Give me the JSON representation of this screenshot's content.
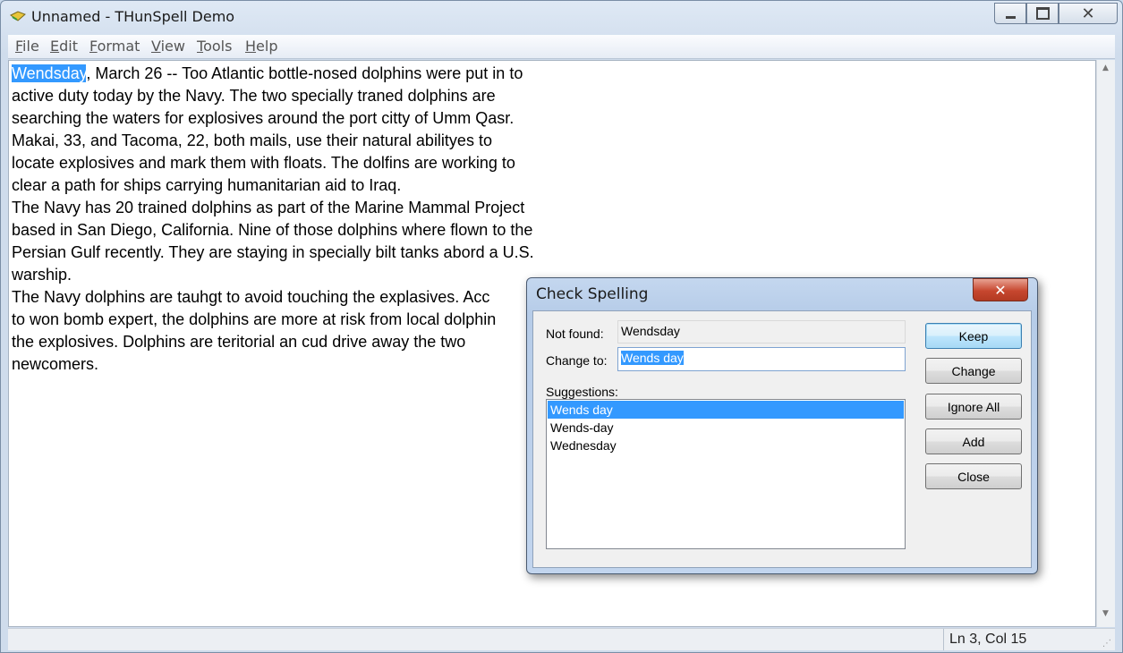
{
  "window": {
    "title": "Unnamed - THunSpell Demo"
  },
  "menu": [
    {
      "label": "File",
      "accel": "F",
      "rest": "ile"
    },
    {
      "label": "Edit",
      "accel": "E",
      "rest": "dit"
    },
    {
      "label": "Format",
      "accel": "F",
      "rest": "ormat"
    },
    {
      "label": "View",
      "accel": "V",
      "rest": "iew"
    },
    {
      "label": "Tools",
      "accel": "T",
      "rest": "ools"
    },
    {
      "label": "Help",
      "accel": "H",
      "rest": "elp"
    }
  ],
  "editor": {
    "selected_word": "Wendsday",
    "text_after_selection": ", March 26 -- Too Atlantic bottle-nosed dolphins were put in to\nactive duty today by the Navy. The two specially traned dolphins are\nsearching the waters for explosives around the port citty of Umm Qasr.\nMakai, 33, and Tacoma, 22, both mails, use their natural abilityes to\nlocate explosives and mark them with floats. The dolfins are working to\nclear a path for ships carrying humanitarian aid to Iraq.\nThe Navy has 20 trained dolphins as part of the Marine Mammal Project\nbased in San Diego, California. Nine of those dolphins where flown to the\nPersian Gulf recently. They are staying in specially bilt tanks abord a U.S.\nwarship.\nThe Navy dolphins are tauhgt to avoid touching the explasives. Acc\nto won bomb expert, the dolphins are more at risk from local dolphin\nthe explosives. Dolphins are teritorial an cud drive away the two\nnewcomers."
  },
  "statusbar": {
    "position": "Ln 3, Col 15"
  },
  "dialog": {
    "title": "Check Spelling",
    "not_found_label": "Not found:",
    "not_found_value": "Wendsday",
    "change_to_label": "Change to:",
    "change_to_value": "Wends day",
    "suggestions_label": "Suggestions:",
    "suggestions": [
      "Wends day",
      "Wends-day",
      "Wednesday"
    ],
    "selected_suggestion": 0,
    "buttons": {
      "keep": "Keep",
      "change": "Change",
      "ignore_all": "Ignore All",
      "add": "Add",
      "close": "Close"
    }
  },
  "colors": {
    "selection": "#3399ff",
    "close_red": "#c7472f"
  }
}
